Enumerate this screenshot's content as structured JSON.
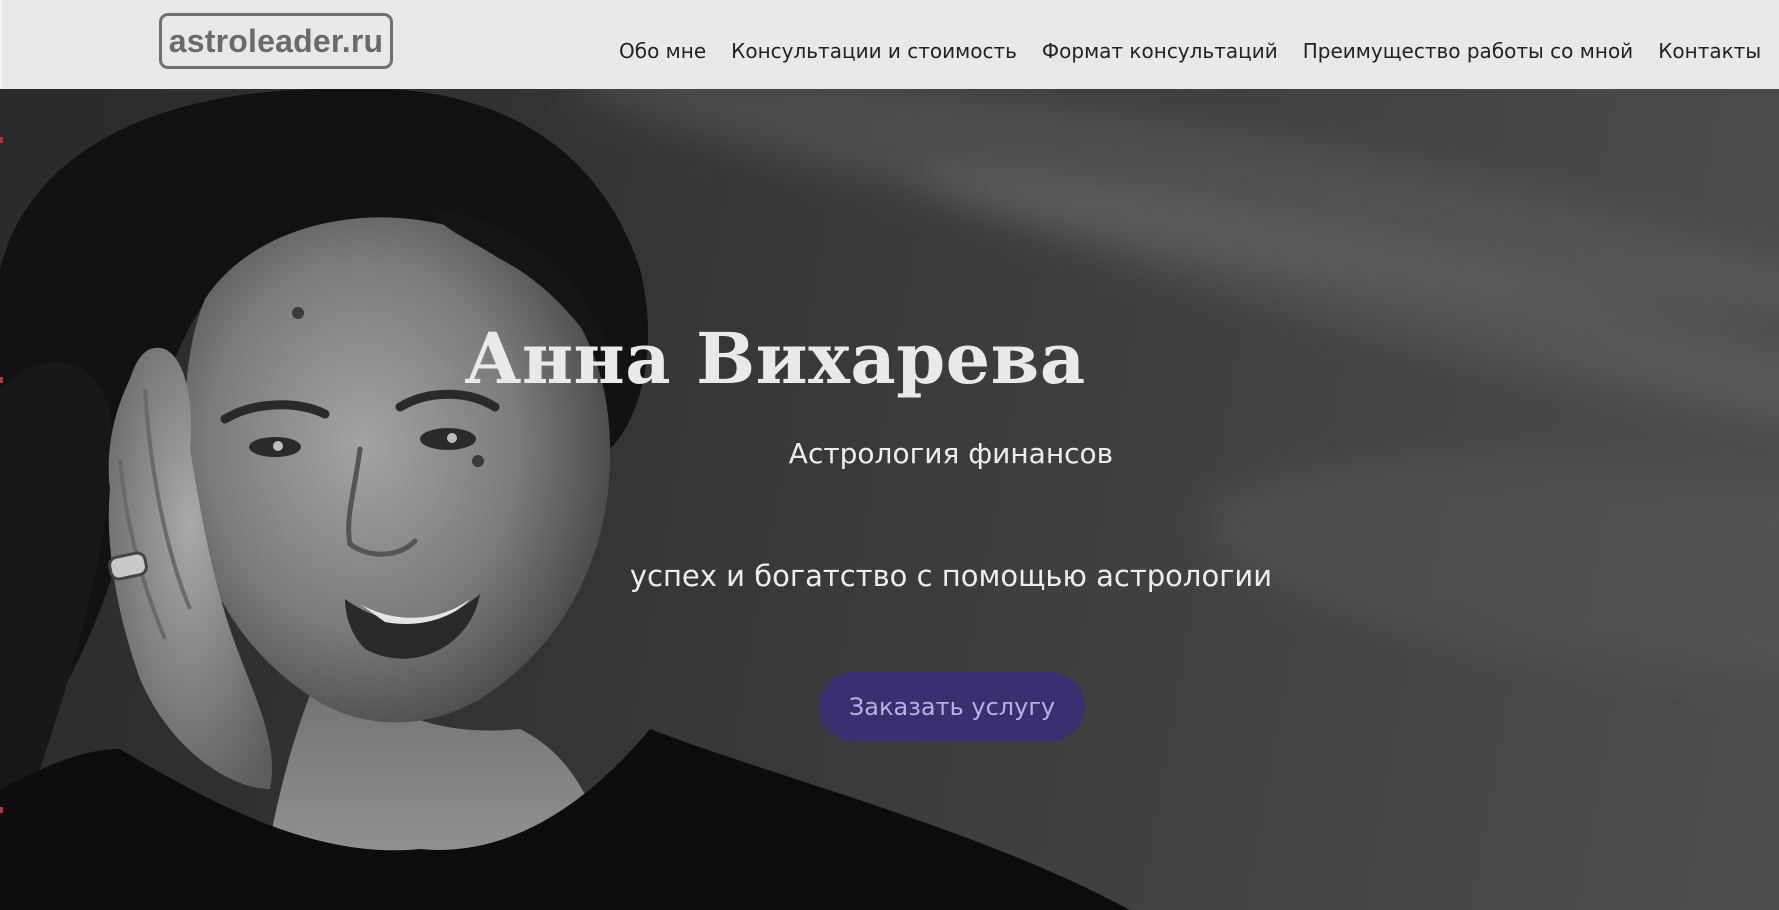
{
  "header": {
    "logo_text": "astroleader.ru",
    "nav": [
      {
        "label": "Обо мне"
      },
      {
        "label": "Консультации и стоимость"
      },
      {
        "label": "Формат консультаций"
      },
      {
        "label": "Преимущество работы со мной"
      },
      {
        "label": "Контакты"
      }
    ]
  },
  "hero": {
    "name": "Анна Вихарева",
    "subtitle": "Астрология финансов",
    "tagline": "успех и богатство с помощью астрологии",
    "cta_label": "Заказать услугу",
    "photo_description_icon": "portrait-photo"
  },
  "colors": {
    "header_bg": "#e8e8e8",
    "logo": "#6a6a6a",
    "nav_text": "#222222",
    "cta_bg": "#3b2f72",
    "cta_text": "#b8b1e0",
    "hero_text": "#ededed"
  }
}
